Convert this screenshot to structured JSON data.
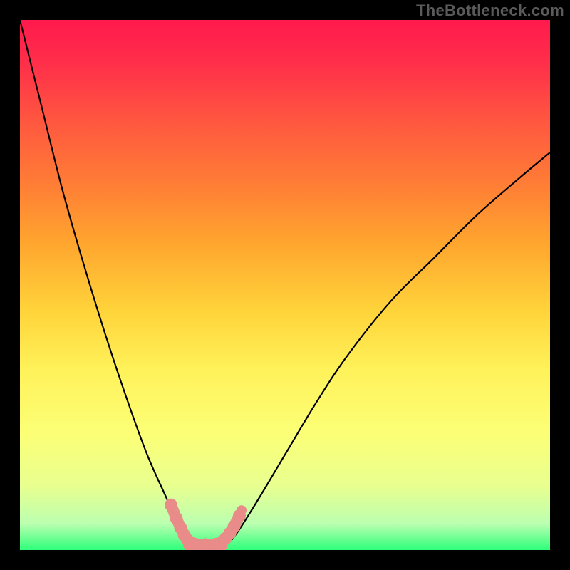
{
  "watermark": "TheBottleneck.com",
  "chart_data": {
    "type": "line",
    "title": "",
    "xlabel": "",
    "ylabel": "",
    "xlim": [
      0,
      100
    ],
    "ylim": [
      0,
      100
    ],
    "x_crit_range": [
      29,
      40
    ],
    "curve_left": {
      "name": "left-branch",
      "x": [
        0,
        4,
        8,
        12,
        16,
        20,
        24,
        28,
        30,
        31,
        32
      ],
      "y": [
        100,
        84,
        68,
        54,
        41,
        29,
        18,
        9,
        4,
        2,
        1
      ]
    },
    "curve_right": {
      "name": "right-branch",
      "x": [
        38,
        40,
        44,
        50,
        56,
        62,
        70,
        78,
        86,
        94,
        100
      ],
      "y": [
        1,
        2,
        8,
        18,
        28,
        37,
        47,
        55,
        63,
        70,
        75
      ]
    },
    "floor": {
      "name": "critical-floor",
      "x": [
        32,
        38
      ],
      "y": [
        1,
        1
      ]
    },
    "markers_left": {
      "name": "left-markers",
      "points": [
        {
          "x": 28.5,
          "y": 8.5
        },
        {
          "x": 29.5,
          "y": 6.0
        },
        {
          "x": 30.3,
          "y": 4.2
        },
        {
          "x": 31.0,
          "y": 2.8
        },
        {
          "x": 31.6,
          "y": 1.9
        },
        {
          "x": 32.2,
          "y": 1.4
        },
        {
          "x": 33.0,
          "y": 1.1
        }
      ]
    },
    "markers_right": {
      "name": "right-markers",
      "points": [
        {
          "x": 37.0,
          "y": 1.1
        },
        {
          "x": 38.0,
          "y": 1.5
        },
        {
          "x": 38.8,
          "y": 2.2
        },
        {
          "x": 39.6,
          "y": 3.2
        },
        {
          "x": 40.4,
          "y": 4.5
        },
        {
          "x": 41.4,
          "y": 6.5
        }
      ]
    },
    "marker_color": "#e98b88",
    "curve_color": "#000000"
  }
}
